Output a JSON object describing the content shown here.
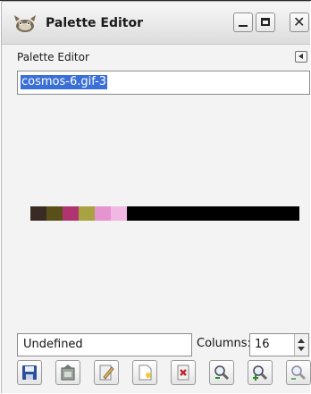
{
  "window": {
    "title": "Palette Editor"
  },
  "dock": {
    "title": "Palette Editor"
  },
  "palette": {
    "name": "cosmos-6.gif-3",
    "swatches": [
      "#3a2a24",
      "#585018",
      "#b03470",
      "#a8a242",
      "#e694cf",
      "#f0b8e2"
    ],
    "strip_fill": "#000000"
  },
  "status": {
    "color_name": "Undefined",
    "columns_label": "Columns:",
    "columns_value": "16"
  },
  "toolbar": {
    "buttons": [
      {
        "name": "save-button",
        "icon": "floppy-disk-icon"
      },
      {
        "name": "revert-button",
        "icon": "revert-icon"
      },
      {
        "name": "edit-color-button",
        "icon": "edit-color-icon"
      },
      {
        "name": "new-color-button",
        "icon": "new-color-icon"
      },
      {
        "name": "delete-color-button",
        "icon": "delete-color-icon"
      },
      {
        "name": "zoom-out-button",
        "icon": "zoom-out-icon"
      },
      {
        "name": "zoom-in-button",
        "icon": "zoom-in-icon"
      },
      {
        "name": "zoom-all-button",
        "icon": "zoom-all-icon"
      }
    ]
  },
  "colors": {
    "selection": "#3b6fd8",
    "background": "#f3f3f3"
  }
}
